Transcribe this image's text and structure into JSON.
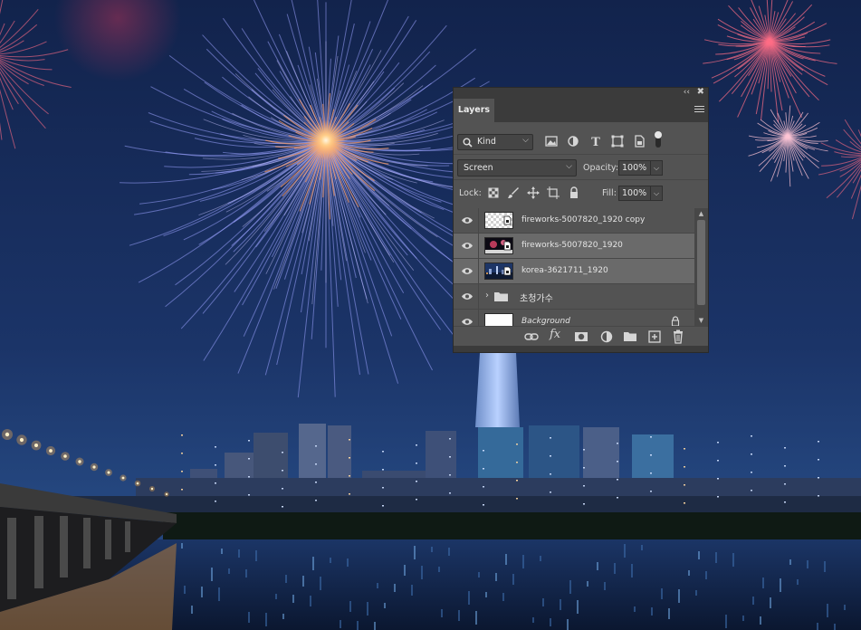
{
  "canvas": {
    "background": "photo-fireworks-over-city-river-night",
    "colors": {
      "sky_top": "#13254f",
      "sky_bottom": "#1e3a70",
      "water": "#0d1c3a",
      "firework_blue": "#9aa3ff",
      "firework_core": "#ffd7a0",
      "firework_red": "#ff6d86"
    }
  },
  "layers_panel": {
    "collapse_icon": "double-chevron-left-icon",
    "close_icon": "close-icon",
    "tab_label": "Layers",
    "menu_icon": "hamburger-menu-icon",
    "filter": {
      "search_icon": "search-icon",
      "kind_label": "Kind",
      "filter_icons": [
        "image-filter-icon",
        "adjustment-filter-icon",
        "type-filter-icon",
        "shape-filter-icon",
        "smart-object-filter-icon"
      ],
      "toggle_icon": "filter-toggle-icon"
    },
    "blend": {
      "mode": "Screen",
      "opacity_label": "Opacity:",
      "opacity_value": "100%"
    },
    "lock": {
      "label": "Lock:",
      "icons": [
        "lock-transparent-pixels-icon",
        "lock-image-pixels-icon",
        "lock-position-icon",
        "lock-artboard-icon",
        "lock-all-icon"
      ],
      "fill_label": "Fill:",
      "fill_value": "100%"
    },
    "layers": [
      {
        "name": "fireworks-5007820_1920 copy",
        "visible": true,
        "selected": false,
        "thumb": "transparent",
        "italic": false
      },
      {
        "name": "fireworks-5007820_1920",
        "visible": true,
        "selected": true,
        "thumb": "fireworks",
        "italic": false
      },
      {
        "name": "korea-3621711_1920",
        "visible": true,
        "selected": true,
        "thumb": "city",
        "italic": false
      },
      {
        "name": "초청가수",
        "visible": true,
        "selected": false,
        "thumb": "folder",
        "italic": false
      },
      {
        "name": "Background",
        "visible": true,
        "selected": false,
        "thumb": "white",
        "italic": true,
        "locked": true
      }
    ],
    "bottom_icons": [
      "link-layers-icon",
      "fx-icon",
      "add-mask-icon",
      "adjustment-layer-icon",
      "new-group-icon",
      "new-layer-icon",
      "trash-icon"
    ],
    "fx_text": "fx"
  }
}
